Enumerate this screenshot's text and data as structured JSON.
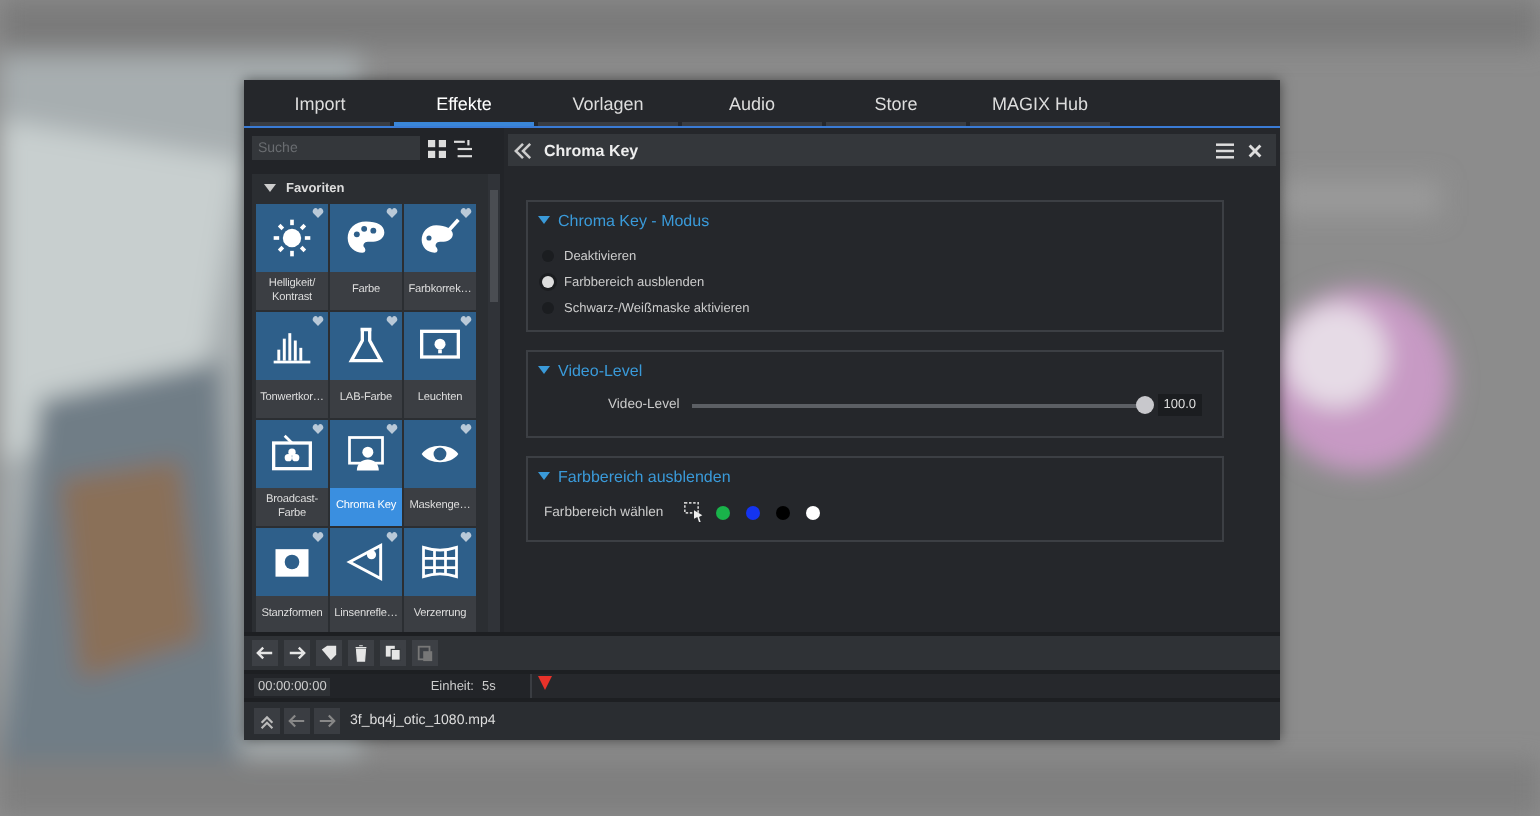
{
  "tabs": [
    {
      "label": "Import",
      "selected": false
    },
    {
      "label": "Effekte",
      "selected": true
    },
    {
      "label": "Vorlagen",
      "selected": false
    },
    {
      "label": "Audio",
      "selected": false
    },
    {
      "label": "Store",
      "selected": false
    },
    {
      "label": "MAGIX Hub",
      "selected": false
    }
  ],
  "browser": {
    "search": {
      "placeholder": "Suche"
    },
    "group": "Favoriten",
    "tiles": [
      {
        "label": "Helligkeit/ Kontrast",
        "selected": false
      },
      {
        "label": "Farbe",
        "selected": false
      },
      {
        "label": "Farbkorrek…",
        "selected": false
      },
      {
        "label": "Tonwertkor…",
        "selected": false
      },
      {
        "label": "LAB-Farbe",
        "selected": false
      },
      {
        "label": "Leuchten",
        "selected": false
      },
      {
        "label": "Broadcast-Farbe",
        "selected": false
      },
      {
        "label": "Chroma Key",
        "selected": true
      },
      {
        "label": "Maskenge…",
        "selected": false
      },
      {
        "label": "Stanzformen",
        "selected": false
      },
      {
        "label": "Linsenrefle…",
        "selected": false
      },
      {
        "label": "Verzerrung",
        "selected": false
      }
    ]
  },
  "panel": {
    "title": "Chroma Key",
    "sections": [
      {
        "kind": "radios",
        "title": "Chroma Key - Modus",
        "options": [
          {
            "label": "Deaktivieren",
            "selected": false
          },
          {
            "label": "Farbbereich ausblenden",
            "selected": true
          },
          {
            "label": "Schwarz-/Weißmaske aktivieren",
            "selected": false
          }
        ]
      },
      {
        "kind": "slider",
        "title": "Video-Level",
        "label": "Video-Level",
        "level": 1.0,
        "reading": "100.0"
      },
      {
        "kind": "colors",
        "title": "Farbbereich ausblenden",
        "label": "Farbbereich wählen",
        "swatches": [
          {
            "color": "#19b34a"
          },
          {
            "color": "#1434f0"
          },
          {
            "color": "#000000"
          },
          {
            "color": "#ffffff"
          }
        ]
      }
    ]
  },
  "toolbar": [
    {
      "kind": "left",
      "disabled": false
    },
    {
      "kind": "right",
      "disabled": false
    },
    {
      "kind": "tag",
      "disabled": false
    },
    {
      "kind": "trash",
      "disabled": false
    },
    {
      "kind": "copy",
      "disabled": false
    },
    {
      "kind": "paste",
      "disabled": true
    }
  ],
  "timeline": {
    "timecode": "00:00:00:00",
    "unit_label": "Einheit:",
    "unit": "5s"
  },
  "file_bar": {
    "filename": "3f_bq4j_otic_1080.mp4"
  }
}
